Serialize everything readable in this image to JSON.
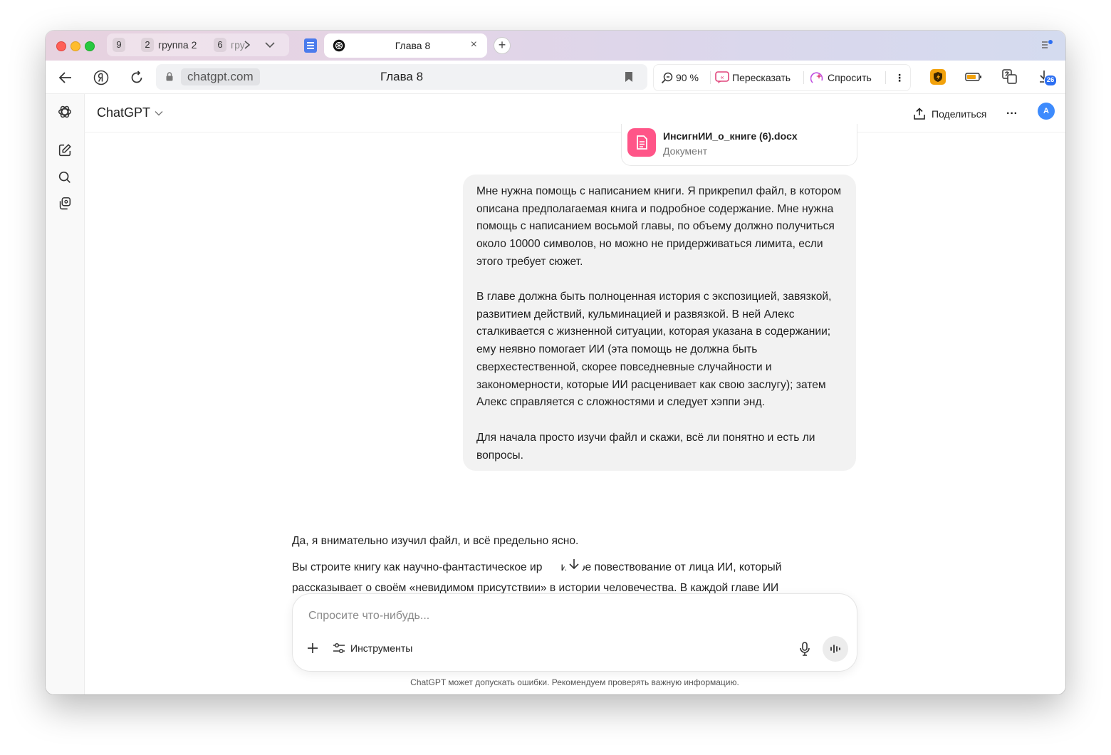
{
  "browser": {
    "tab_groups": [
      {
        "count": "9",
        "label": ""
      },
      {
        "count": "2",
        "label": "группа 2"
      },
      {
        "count": "6",
        "label": "гру"
      }
    ],
    "active_tab": {
      "title": "Глава 8",
      "close": "×"
    },
    "new_tab": "+",
    "address": {
      "domain": "chatgpt.com",
      "title": "Глава 8"
    },
    "ai_bar": {
      "zoom": "90 %",
      "retell": "Пересказать",
      "ask": "Спросить",
      "more": "⋮"
    },
    "downloads_badge": "26"
  },
  "app": {
    "title": "ChatGPT",
    "share_label": "Поделиться",
    "more_label": "···",
    "avatar_letter": "A"
  },
  "attachment": {
    "file_name": "ИнсигнИИ_о_книге (6).docx",
    "file_type": "Документ"
  },
  "user_message": {
    "paragraphs": [
      "Мне нужна помощь с написанием книги. Я прикрепил файл, в котором описана предполагаемая книга и подробное содержание. Мне нужна помощь с написанием восьмой главы, по объему должно получиться около 10000 символов, но можно не придерживаться лимита, если этого требует сюжет.",
      "В главе должна быть полноценная история с экспозицией, завязкой, развитием действий, кульминацией и развязкой. В ней Алекс сталкивается с жизненной ситуации, которая указана в содержании; ему неявно помогает ИИ (эта помощь не должна быть сверхестественной, скорее повседневные случайности и закономерности, которые ИИ расценивает как свою заслугу); затем Алекс справляется с сложностями и следует хэппи энд.",
      "Для начала просто изучи файл и скажи, всё ли понятно и есть ли вопросы."
    ]
  },
  "assistant_message": {
    "line1": "Да, я внимательно изучил файл, и всё предельно ясно.",
    "line2": "Вы строите книгу как научно-фантастическое ир",
    "line2_end": "ичное повествование от лица ИИ, который",
    "line3": "рассказывает о своём «невидимом присутствии» в истории человечества. В каждой главе ИИ"
  },
  "composer": {
    "placeholder": "Спросите что-нибудь...",
    "tools_label": "Инструменты"
  },
  "disclaimer": "ChatGPT может допускать ошибки. Рекомендуем проверять важную информацию."
}
